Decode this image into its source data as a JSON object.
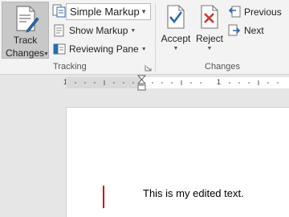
{
  "tracking": {
    "track_changes": {
      "line1": "Track",
      "line2": "Changes"
    },
    "markup_select": {
      "value": "Simple Markup"
    },
    "show_markup_label": "Show Markup",
    "reviewing_pane_label": "Reviewing Pane",
    "group_label": "Tracking"
  },
  "changes": {
    "accept_label": "Accept",
    "reject_label": "Reject",
    "previous_label": "Previous",
    "next_label": "Next",
    "group_label": "Changes"
  },
  "ruler": {
    "left_number": "1",
    "right_number": "1"
  },
  "document": {
    "text": "This is my edited text."
  },
  "colors": {
    "change_bar": "#d00000",
    "accent_blue": "#2b6cb0",
    "reject_red": "#d0342c"
  }
}
